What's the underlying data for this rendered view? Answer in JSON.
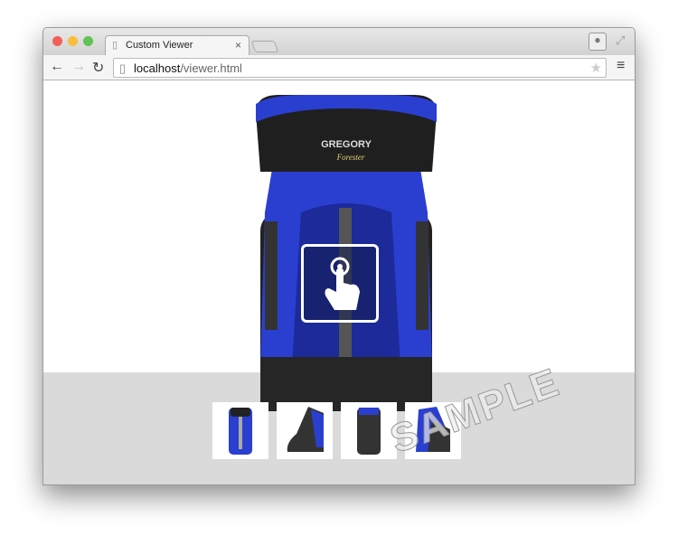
{
  "browser": {
    "tab_title": "Custom Viewer",
    "tab_close": "×",
    "url_host": "localhost",
    "url_path": "/viewer.html",
    "icons": [
      "back-arrow-icon",
      "forward-arrow-icon",
      "reload-icon",
      "page-icon",
      "star-icon",
      "menu-icon",
      "profile-icon",
      "fullscreen-icon"
    ]
  },
  "viewer": {
    "product_logo": "GREGORY",
    "product_model": "Forester",
    "watermark": "SAMPLE",
    "touch_icon": "tap-hand-icon",
    "thumbnails": [
      {
        "view": "front"
      },
      {
        "view": "side-left"
      },
      {
        "view": "back"
      },
      {
        "view": "side-right"
      }
    ],
    "colors": {
      "pack_blue": "#2a3fd0",
      "pack_black": "#222222"
    }
  }
}
